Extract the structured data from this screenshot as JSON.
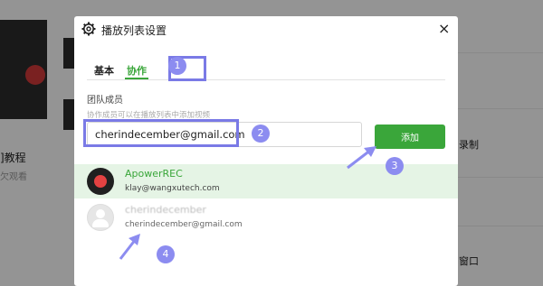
{
  "background": {
    "left_title": "]教程",
    "left_subtitle": "欠观看",
    "right_item_1": "录制",
    "right_item_2": "窗口"
  },
  "dialog": {
    "title": "播放列表设置",
    "close": "×",
    "tabs": [
      {
        "label": "基本",
        "active": false
      },
      {
        "label": "协作",
        "active": true
      }
    ],
    "section_title": "团队成员",
    "section_hint": "协作成员可以在播放列表中添加视频",
    "email_input": {
      "value": "cherindecember@gmail.com"
    },
    "add_button": "添加",
    "members": [
      {
        "name": "ApowerREC",
        "email": "klay@wangxutech.com",
        "highlighted": true
      },
      {
        "name": "cherindecember",
        "email": "cherindecember@gmail.com",
        "highlighted": false
      }
    ]
  },
  "annotations": {
    "steps": [
      "1",
      "2",
      "3",
      "4"
    ],
    "highlight_color": "#7a7ae6"
  },
  "colors": {
    "accent": "#3aa63a",
    "member_highlight": "#e5f4e5"
  }
}
